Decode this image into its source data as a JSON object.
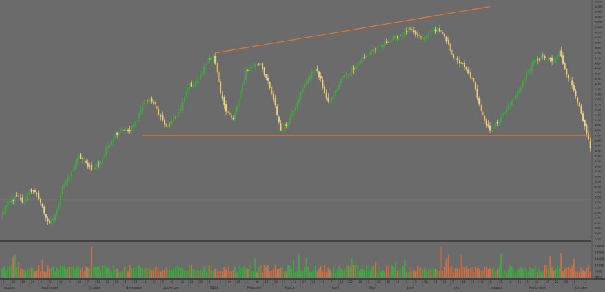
{
  "colors": {
    "background": "#6b6b6b",
    "up_candle": "#3fa83f",
    "down_candle": "#f0cf7a",
    "trendline": "#e8782e",
    "axis_text": "#1e1e1e",
    "divider": "#1a1a1a",
    "volume_up": "#3fa83f",
    "volume_down": "#d07040"
  },
  "chart_data": [
    {
      "type": "candlestick",
      "title": "",
      "xlabel": "",
      "ylabel": "",
      "ylim": [
        7950,
        10250
      ],
      "ytick_labels": [
        "10250",
        "10200",
        "10150",
        "10100",
        "10050",
        "10000",
        "9950",
        "9900",
        "9850",
        "9800",
        "9750",
        "9700",
        "9650",
        "9600",
        "9550",
        "9500",
        "9450",
        "9400",
        "9350",
        "9300",
        "9250",
        "9200",
        "9150",
        "9100",
        "9050",
        "9000",
        "8950",
        "8900",
        "8850",
        "8800",
        "8750",
        "8700",
        "8650",
        "8600",
        "8550",
        "8500",
        "8450",
        "8400",
        "8350",
        "8300",
        "8250",
        "8200",
        "8150",
        "8100",
        "8050",
        "8000",
        "7950"
      ],
      "month_labels": [
        "August",
        "September",
        "October",
        "November",
        "December",
        "2014",
        "February",
        "March",
        "April",
        "May",
        "June",
        "July",
        "August",
        "September",
        "October"
      ],
      "day_labels": [
        "5",
        "12",
        "19",
        "26",
        "2",
        "9",
        "16",
        "23",
        "30",
        "7",
        "14",
        "21",
        "28",
        "4",
        "11",
        "18",
        "25",
        "2",
        "9",
        "16",
        "23",
        "30",
        "6",
        "13",
        "20",
        "27",
        "3",
        "10",
        "17",
        "24",
        "3",
        "10",
        "17",
        "24",
        "31",
        "7",
        "14",
        "22",
        "28",
        "5",
        "12",
        "19",
        "26",
        "2",
        "9",
        "16",
        "23",
        "30",
        "7",
        "14",
        "21",
        "28",
        "4",
        "11",
        "18",
        "25",
        "1",
        "8",
        "15",
        "22",
        "29",
        "6",
        "13"
      ],
      "anchors": [
        [
          0,
          8180
        ],
        [
          3,
          8290
        ],
        [
          8,
          8360
        ],
        [
          12,
          8290
        ],
        [
          15,
          8430
        ],
        [
          20,
          8350
        ],
        [
          23,
          8200
        ],
        [
          26,
          8080
        ],
        [
          30,
          8210
        ],
        [
          33,
          8460
        ],
        [
          37,
          8540
        ],
        [
          42,
          8750
        ],
        [
          47,
          8660
        ],
        [
          50,
          8620
        ],
        [
          54,
          8700
        ],
        [
          58,
          8850
        ],
        [
          62,
          8960
        ],
        [
          66,
          9010
        ],
        [
          70,
          8990
        ],
        [
          73,
          9080
        ],
        [
          78,
          9280
        ],
        [
          82,
          9290
        ],
        [
          85,
          9200
        ],
        [
          90,
          9020
        ],
        [
          94,
          9100
        ],
        [
          98,
          9200
        ],
        [
          102,
          9430
        ],
        [
          105,
          9450
        ],
        [
          108,
          9500
        ],
        [
          110,
          9560
        ],
        [
          113,
          9700
        ],
        [
          116,
          9720
        ],
        [
          118,
          9550
        ],
        [
          120,
          9350
        ],
        [
          123,
          9200
        ],
        [
          127,
          9100
        ],
        [
          131,
          9360
        ],
        [
          134,
          9580
        ],
        [
          138,
          9630
        ],
        [
          142,
          9650
        ],
        [
          146,
          9460
        ],
        [
          150,
          9230
        ],
        [
          153,
          9000
        ],
        [
          156,
          9050
        ],
        [
          160,
          9200
        ],
        [
          164,
          9360
        ],
        [
          168,
          9500
        ],
        [
          172,
          9600
        ],
        [
          175,
          9480
        ],
        [
          179,
          9260
        ],
        [
          183,
          9370
        ],
        [
          187,
          9520
        ],
        [
          191,
          9560
        ],
        [
          195,
          9650
        ],
        [
          199,
          9700
        ],
        [
          203,
          9780
        ],
        [
          207,
          9800
        ],
        [
          211,
          9860
        ],
        [
          215,
          9890
        ],
        [
          219,
          9920
        ],
        [
          223,
          9970
        ],
        [
          227,
          9930
        ],
        [
          231,
          9880
        ],
        [
          235,
          9950
        ],
        [
          239,
          9990
        ],
        [
          243,
          9900
        ],
        [
          246,
          9780
        ],
        [
          249,
          9680
        ],
        [
          252,
          9650
        ],
        [
          255,
          9580
        ],
        [
          259,
          9450
        ],
        [
          263,
          9200
        ],
        [
          266,
          9050
        ],
        [
          269,
          9000
        ],
        [
          272,
          9080
        ],
        [
          276,
          9180
        ],
        [
          280,
          9280
        ],
        [
          284,
          9390
        ],
        [
          288,
          9550
        ],
        [
          292,
          9660
        ],
        [
          296,
          9710
        ],
        [
          300,
          9690
        ],
        [
          303,
          9660
        ],
        [
          306,
          9760
        ],
        [
          309,
          9600
        ],
        [
          312,
          9480
        ],
        [
          315,
          9350
        ],
        [
          318,
          9150
        ],
        [
          320,
          9020
        ],
        [
          322,
          8900
        ],
        [
          323,
          8830
        ]
      ],
      "support_level": 8950,
      "resistance_start": [
        117,
        9750
      ],
      "resistance_end": [
        268,
        10200
      ],
      "support_start": [
        77,
        8950
      ],
      "support_end": [
        323,
        8950
      ]
    },
    {
      "type": "bar",
      "title": "",
      "ylabel": "Volume",
      "ylim": [
        0,
        27500
      ],
      "ytick_labels": [
        "25000",
        "20000",
        "15000",
        "10000",
        "5000",
        "0"
      ],
      "axis_tag": "(Mln)"
    }
  ]
}
